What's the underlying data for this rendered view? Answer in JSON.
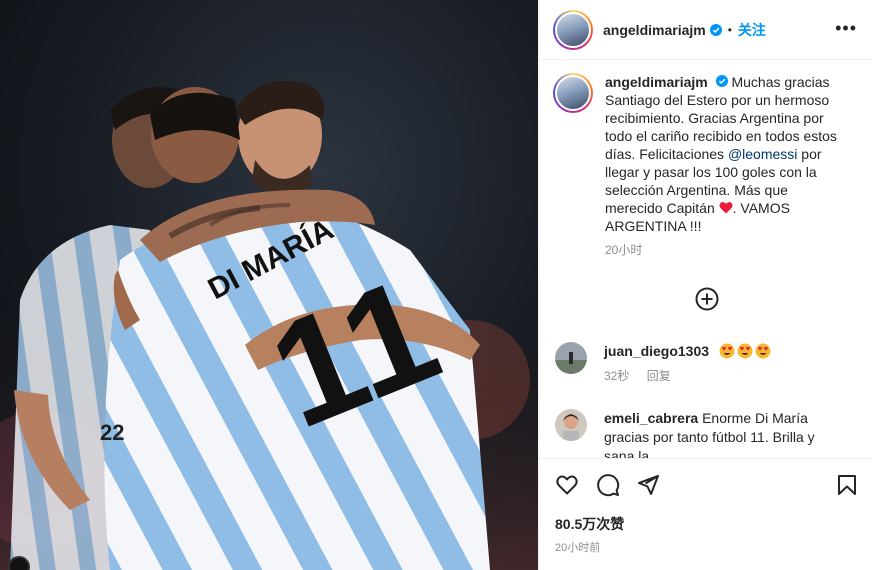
{
  "header": {
    "username": "angeldimariajm",
    "separator": "•",
    "follow_label": "关注",
    "more_label": "•••"
  },
  "caption": {
    "username": "angeldimariajm",
    "text_part1": "Muchas gracias Santiago del Estero por un hermoso recibimiento. Gracias Argentina por todo el cariño recibido en todos estos días. Felicitaciones ",
    "mention": "@leomessi",
    "text_part2": " por llegar y pasar los 100 goles con la selección Argentina. Más que merecido Capitán ",
    "text_part3": ". VAMOS ARGENTINA !!!",
    "time": "20小时"
  },
  "comments": [
    {
      "username": "juan_diego1303",
      "emojis": [
        "heart-eyes-emoji",
        "heart-eyes-emoji",
        "heart-eyes-emoji"
      ],
      "time": "32秒",
      "reply_label": "回复"
    },
    {
      "username": "emeli_cabrera",
      "text": "Enorme Di María gracias por tanto fútbol 11. Brilla y sana la"
    }
  ],
  "photo": {
    "jersey_name": "DI MARÍA",
    "jersey_number": "11",
    "jersey_number_small": "22"
  },
  "footer": {
    "likes": "80.5万次赞",
    "post_time": "20小时前"
  },
  "icons": {
    "like": "heart-outline-icon",
    "comment": "speech-bubble-icon",
    "share": "paper-plane-icon",
    "save": "bookmark-icon",
    "add": "plus-circle-icon",
    "more": "ellipsis-icon",
    "verified": "verified-badge-icon"
  },
  "colors": {
    "accent": "#0095f6",
    "verified": "#0095f6",
    "heart_emoji": "#ed1c3a",
    "mention": "#00376b",
    "meta_text": "#8e8e8e"
  }
}
